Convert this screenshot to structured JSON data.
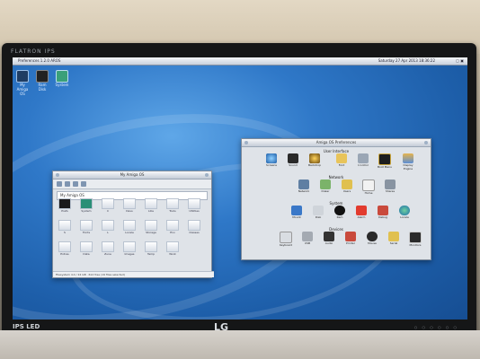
{
  "monitor": {
    "model_text": "FLATRON IPS",
    "panel_badge": "IPS LED",
    "brand": "LG",
    "buttons_label": "○ ○ ○ ○ ○ ○"
  },
  "desktop": {
    "menubar": {
      "title": "Preferences 1.2.0 AROS",
      "clock": "Saturday 27 Apr 2013 18:36:22",
      "right": "▢ ▣"
    },
    "icons": [
      {
        "label": "My Amiga OS"
      },
      {
        "label": "Ram Disk"
      },
      {
        "label": "System"
      }
    ],
    "accent": "#2f78c8"
  },
  "file_window": {
    "title": "My Amiga OS",
    "path": "My Amiga OS",
    "status": "Filesystem 4.0 / 24 GB · 612 free (19 files selected)",
    "items": [
      {
        "label": "Prefs"
      },
      {
        "label": "System"
      },
      {
        "label": "C"
      },
      {
        "label": "Devs"
      },
      {
        "label": "Libs"
      },
      {
        "label": "Tools"
      },
      {
        "label": "Utilities"
      },
      {
        "label": "S"
      },
      {
        "label": "Fonts"
      },
      {
        "label": "L"
      },
      {
        "label": "Locale"
      },
      {
        "label": "Storage"
      },
      {
        "label": "Env"
      },
      {
        "label": "Classes"
      },
      {
        "label": "Extras"
      },
      {
        "label": "Data"
      },
      {
        "label": "Zune"
      },
      {
        "label": "Images"
      },
      {
        "label": "Temp"
      },
      {
        "label": "Work"
      }
    ]
  },
  "prefs_window": {
    "title": "Amiga OS Preferences",
    "sections": [
      {
        "title": "User Interface",
        "items": [
          {
            "label": "Screens"
          },
          {
            "label": "Sound"
          },
          {
            "label": "Backdrop"
          },
          {
            "label": "Font"
          },
          {
            "label": "Icontrol"
          },
          {
            "label": "Boot Menu"
          },
          {
            "label": "Display Engine"
          }
        ]
      },
      {
        "title": "Network",
        "items": [
          {
            "label": "Network"
          },
          {
            "label": "Dialer"
          },
          {
            "label": "Users"
          },
          {
            "label": "Home"
          },
          {
            "label": "Shares"
          }
        ]
      },
      {
        "title": "System",
        "items": [
          {
            "label": "Mount"
          },
          {
            "label": "Disk"
          },
          {
            "label": "Ram"
          },
          {
            "label": "Alarm"
          },
          {
            "label": "Debug"
          },
          {
            "label": "Locale"
          }
        ]
      },
      {
        "title": "Devices",
        "items": [
          {
            "label": "Keyboard"
          },
          {
            "label": "USB"
          },
          {
            "label": "Audio"
          },
          {
            "label": "Printer"
          },
          {
            "label": "Mouse"
          },
          {
            "label": "Serial"
          },
          {
            "label": "Monitors"
          }
        ]
      }
    ]
  }
}
